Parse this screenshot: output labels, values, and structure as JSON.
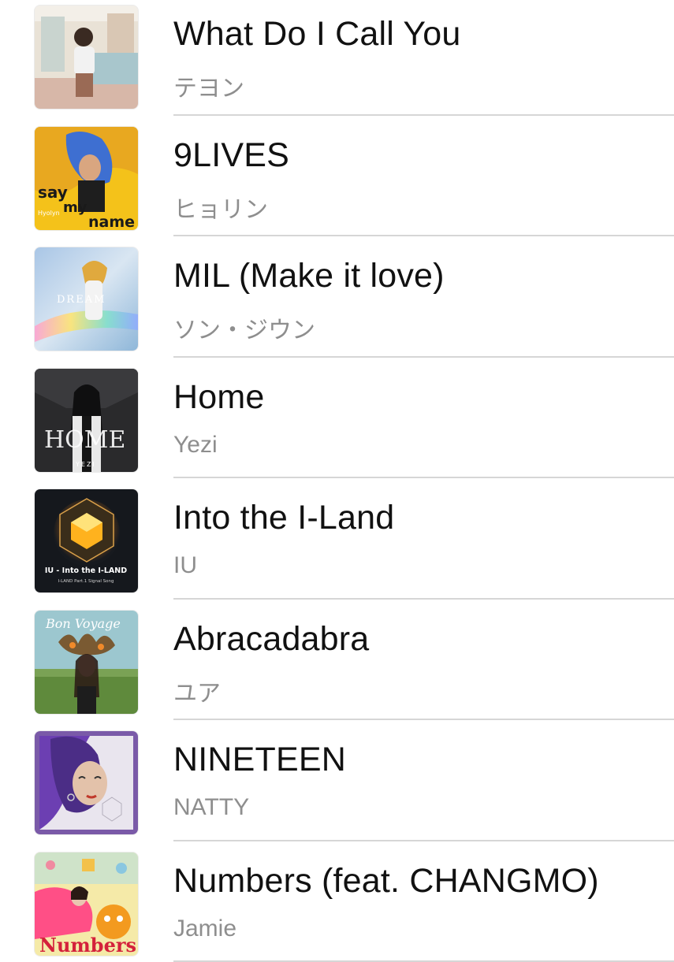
{
  "tracks": [
    {
      "title": "What Do I Call You",
      "artist": "テヨン",
      "art_icon": "album-art-what-do-i-call-you"
    },
    {
      "title": "9LIVES",
      "artist": "ヒョリン",
      "art_icon": "album-art-say-my-name",
      "art_text": [
        "say",
        "my",
        "name",
        "Hyolyn"
      ]
    },
    {
      "title": "MIL (Make it love)",
      "artist": "ソン・ジウン",
      "art_icon": "album-art-dream",
      "art_text": [
        "DREAM"
      ]
    },
    {
      "title": "Home",
      "artist": "Yezi",
      "art_icon": "album-art-home",
      "art_text": [
        "HOME",
        "YEZI"
      ]
    },
    {
      "title": "Into the I-Land",
      "artist": "IU",
      "art_icon": "album-art-into-the-i-land",
      "art_text": [
        "IU - Into the I-LAND",
        "I-LAND Part.1 Signal Song"
      ]
    },
    {
      "title": "Abracadabra",
      "artist": "ユア",
      "art_icon": "album-art-bon-voyage",
      "art_text": [
        "Bon Voyage"
      ]
    },
    {
      "title": "NINETEEN",
      "artist": "NATTY",
      "art_icon": "album-art-nineteen"
    },
    {
      "title": "Numbers (feat. CHANGMO)",
      "artist": "Jamie",
      "art_icon": "album-art-numbers",
      "art_text": [
        "Numbers"
      ]
    }
  ]
}
